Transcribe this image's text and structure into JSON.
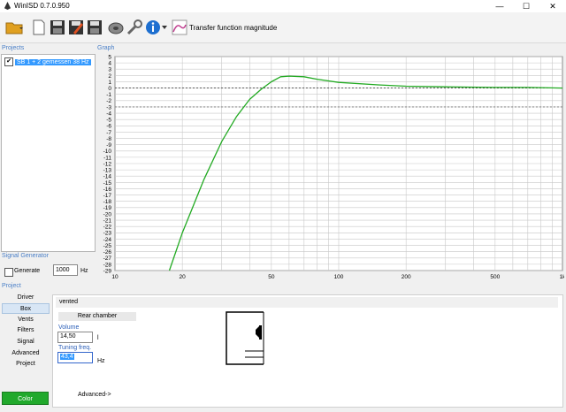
{
  "window": {
    "title": "WinISD 0.7.0.950",
    "minimize": "—",
    "maximize": "☐",
    "close": "✕"
  },
  "toolbar": {
    "graph_label": "Transfer function magnitude",
    "icons": [
      "open-folder-icon",
      "new-document-icon",
      "save-icon",
      "save-as-icon",
      "save-all-icon",
      "driver-icon",
      "tools-icon",
      "info-icon",
      "graph-icon"
    ]
  },
  "sections": {
    "projects": "Projects",
    "graph": "Graph",
    "signal_generator": "Signal Generator",
    "project": "Project"
  },
  "projects": [
    {
      "name": "SB 1 + 2 gemessen 38 Hz",
      "checked": true
    }
  ],
  "signal_generator": {
    "label": "Generate",
    "value": "1000",
    "unit": "Hz",
    "checked": false
  },
  "nav": [
    "Driver",
    "Box",
    "Vents",
    "Filters",
    "Signal",
    "Advanced",
    "Project"
  ],
  "nav_active": "Box",
  "color_button": "Color",
  "box": {
    "type": "vented",
    "rear_chamber": "Rear chamber",
    "volume_label": "Volume",
    "volume": "14,50",
    "volume_unit": "l",
    "tuning_label": "Tuning freq.",
    "tuning": "43,4",
    "tuning_unit": "Hz",
    "advanced_link": "Advanced->"
  },
  "chart_data": {
    "type": "line",
    "title": "",
    "xscale": "log",
    "xlim": [
      10,
      1000
    ],
    "ylim": [
      -29,
      5
    ],
    "yticks": [
      5,
      4,
      3,
      2,
      1,
      0,
      -1,
      -2,
      -3,
      -4,
      -5,
      -6,
      -7,
      -8,
      -9,
      -10,
      -11,
      -12,
      -13,
      -14,
      -15,
      -16,
      -17,
      -18,
      -19,
      -20,
      -21,
      -22,
      -23,
      -24,
      -25,
      -26,
      -27,
      -28,
      -29
    ],
    "xtick_labels": [
      {
        "v": 10,
        "t": "10"
      },
      {
        "v": 20,
        "t": "20"
      },
      {
        "v": 50,
        "t": "50"
      },
      {
        "v": 100,
        "t": "100"
      },
      {
        "v": 200,
        "t": "200"
      },
      {
        "v": 500,
        "t": "500"
      },
      {
        "v": 1000,
        "t": "1k"
      }
    ],
    "reference_lines": [
      0,
      -3
    ],
    "grid": true,
    "series": [
      {
        "color": "#22aa22",
        "x": [
          17.5,
          20,
          25,
          30,
          35,
          40,
          45,
          50,
          55,
          60,
          70,
          80,
          100,
          150,
          200,
          300,
          500,
          700,
          1000
        ],
        "y": [
          -29.5,
          -23,
          -14.5,
          -8.5,
          -4.5,
          -1.8,
          -0.2,
          1.0,
          1.8,
          1.9,
          1.8,
          1.4,
          0.9,
          0.5,
          0.3,
          0.2,
          0.1,
          0.1,
          0.0
        ]
      }
    ]
  }
}
